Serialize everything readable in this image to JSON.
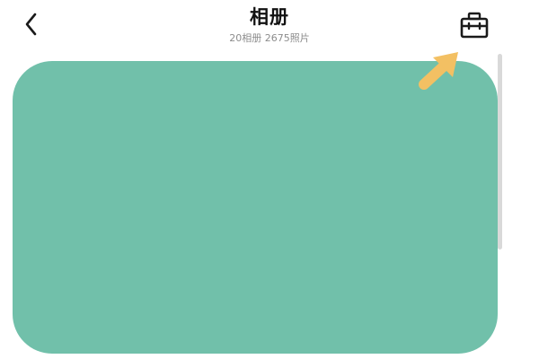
{
  "header": {
    "title": "相册",
    "subtitle": "20相册  2675照片"
  },
  "icons": {
    "back": "chevron-left-icon",
    "tools": "toolbox-icon",
    "hint": "arrow-pointer-icon"
  },
  "colors": {
    "album_card": "#71c0aa",
    "hint_arrow": "#f3c063",
    "scrollbar": "#d9d9d9",
    "icon": "#1a1a1a"
  }
}
